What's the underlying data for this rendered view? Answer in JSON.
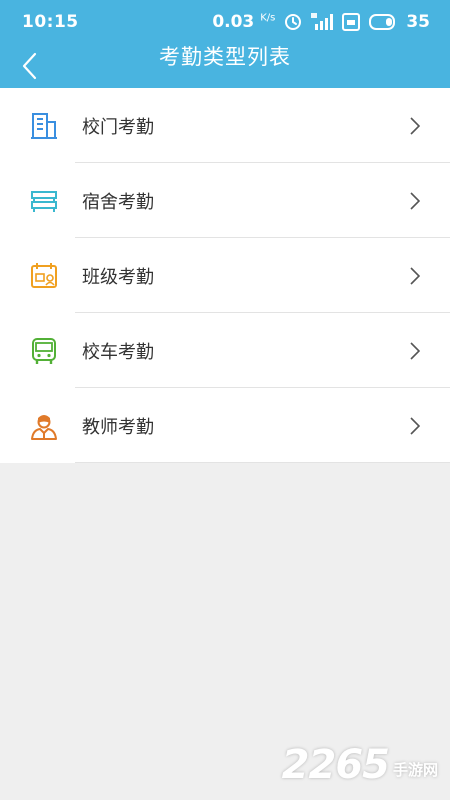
{
  "status_bar": {
    "time": "10:15",
    "net_speed": "0.03",
    "net_unit": "K/s",
    "battery": "35"
  },
  "nav": {
    "title": "考勤类型列表"
  },
  "items": [
    {
      "label": "校门考勤",
      "icon": "building-icon",
      "color": "#3a8fe0"
    },
    {
      "label": "宿舍考勤",
      "icon": "bed-icon",
      "color": "#3ab8cf"
    },
    {
      "label": "班级考勤",
      "icon": "class-calendar-icon",
      "color": "#f0a020"
    },
    {
      "label": "校车考勤",
      "icon": "bus-icon",
      "color": "#52b036"
    },
    {
      "label": "教师考勤",
      "icon": "teacher-icon",
      "color": "#e07a2a"
    }
  ],
  "watermark": {
    "number": "2265",
    "text": "手游网"
  },
  "colors": {
    "header": "#49b4e0",
    "background": "#efefef"
  }
}
